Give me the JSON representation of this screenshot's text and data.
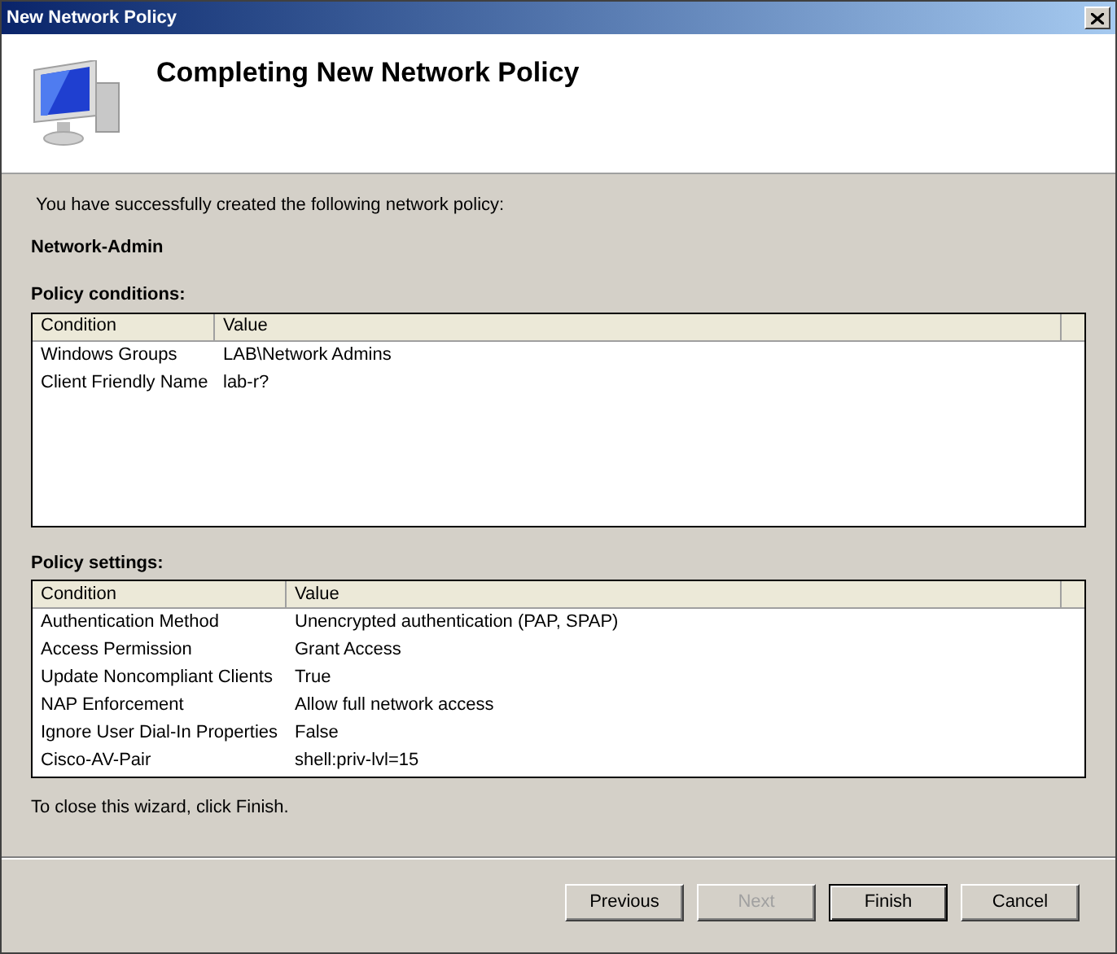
{
  "window": {
    "title": "New Network Policy"
  },
  "header": {
    "title": "Completing New Network Policy"
  },
  "intro": "You have successfully created the following network policy:",
  "policy_name": "Network-Admin",
  "conditions": {
    "label": "Policy conditions:",
    "columns": [
      "Condition",
      "Value"
    ],
    "rows": [
      {
        "condition": "Windows Groups",
        "value": "LAB\\Network Admins"
      },
      {
        "condition": "Client Friendly Name",
        "value": "lab-r?"
      }
    ]
  },
  "settings": {
    "label": "Policy settings:",
    "columns": [
      "Condition",
      "Value"
    ],
    "rows": [
      {
        "condition": "Authentication Method",
        "value": "Unencrypted authentication (PAP, SPAP)"
      },
      {
        "condition": "Access Permission",
        "value": "Grant Access"
      },
      {
        "condition": "Update Noncompliant Clients",
        "value": "True"
      },
      {
        "condition": "NAP Enforcement",
        "value": "Allow full network access"
      },
      {
        "condition": "Ignore User Dial-In Properties",
        "value": "False"
      },
      {
        "condition": "Cisco-AV-Pair",
        "value": "shell:priv-lvl=15"
      }
    ]
  },
  "footer_note": "To close this wizard, click Finish.",
  "buttons": [
    {
      "label": "Previous",
      "disabled": false,
      "default": false
    },
    {
      "label": "Next",
      "disabled": true,
      "default": false
    },
    {
      "label": "Finish",
      "disabled": false,
      "default": true
    },
    {
      "label": "Cancel",
      "disabled": false,
      "default": false
    }
  ]
}
